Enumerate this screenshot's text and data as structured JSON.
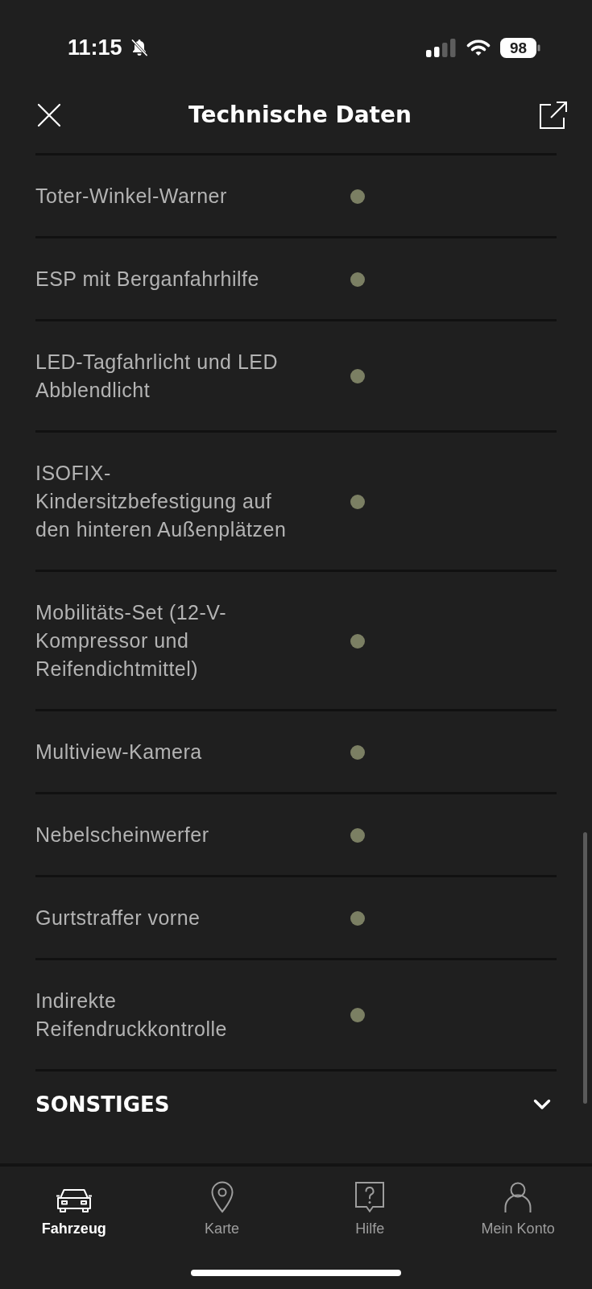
{
  "status_bar": {
    "time": "11:15",
    "battery": "98"
  },
  "header": {
    "title": "Technische Daten"
  },
  "features": [
    {
      "label": "Toter-Winkel-Warner",
      "standard": true
    },
    {
      "label": "ESP mit Berganfahrhilfe",
      "standard": true
    },
    {
      "label": "LED-Tagfahrlicht und LED Abblendlicht",
      "standard": true
    },
    {
      "label": "ISOFIX-Kindersitzbefestigung auf den hinteren Außenplätzen",
      "standard": true
    },
    {
      "label": "Mobilitäts-Set (12-V-Kompressor und Reifendichtmittel)",
      "standard": true
    },
    {
      "label": "Multiview-Kamera",
      "standard": true
    },
    {
      "label": "Nebelscheinwerfer",
      "standard": true
    },
    {
      "label": "Gurtstraffer vorne",
      "standard": true
    },
    {
      "label": "Indirekte Reifendruckkontrolle",
      "standard": true
    }
  ],
  "section": {
    "title": "SONSTIGES",
    "expanded": false
  },
  "tab_bar": [
    {
      "label": "Fahrzeug",
      "selected": true
    },
    {
      "label": "Karte",
      "selected": false
    },
    {
      "label": "Hilfe",
      "selected": false
    },
    {
      "label": "Mein Konto",
      "selected": false
    }
  ]
}
